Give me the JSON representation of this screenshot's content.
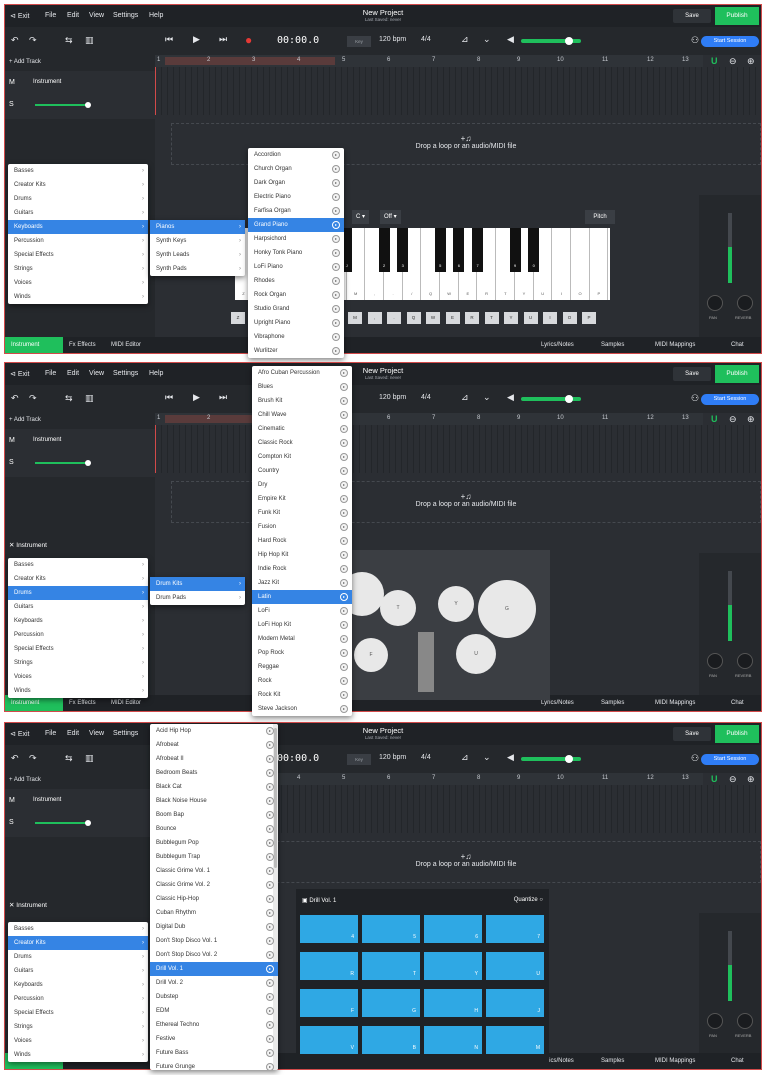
{
  "header": {
    "exit": "Exit",
    "file": "File",
    "edit": "Edit",
    "view": "View",
    "settings": "Settings",
    "help": "Help",
    "title": "New Project",
    "subtitle": "Last Saved: never",
    "save": "Save",
    "publish": "Publish"
  },
  "transport": {
    "time": "00:00.0",
    "key": "Key",
    "tempo": "120 bpm",
    "signature": "4/4",
    "start_session": "Start Session"
  },
  "ruler": [
    "1",
    "2",
    "3",
    "4",
    "5",
    "6",
    "7",
    "8",
    "9",
    "10",
    "11",
    "12",
    "13"
  ],
  "track": {
    "add": "+ Add Track",
    "m": "M",
    "s": "S",
    "name": "Instrument"
  },
  "drop": {
    "icon": "+♫",
    "text": "Drop a loop or an audio/MIDI file"
  },
  "instrument_label": "Instrument",
  "bottom": {
    "instrument": "Instrument",
    "effects": "Fx Effects",
    "midi": "MIDI Editor",
    "lyrics": "Lyrics/Notes",
    "samples": "Samples",
    "mappings": "MIDI Mappings",
    "chat": "Chat"
  },
  "knobs": {
    "pan": "PAN",
    "reverb": "REVERB"
  },
  "categories": [
    "Basses",
    "Creator Kits",
    "Drums",
    "Guitars",
    "Keyboards",
    "Percussion",
    "Special Effects",
    "Strings",
    "Voices",
    "Winds"
  ],
  "piano_ui": {
    "octave": "C",
    "oct_off": "Off",
    "pitch": "Pitch",
    "white_keys": [
      "Z",
      "X",
      "C",
      "V",
      "B",
      "N",
      "M",
      ",",
      ".",
      "/",
      "Q",
      "W",
      "E",
      "R",
      "T",
      "Y",
      "U",
      "I",
      "O",
      "P"
    ],
    "black_keys": [
      "S",
      "D",
      "G",
      "H",
      "J",
      "2",
      "3",
      "5",
      "6",
      "7",
      "9",
      "0"
    ],
    "keyrow": [
      "Z",
      "X",
      "C",
      "V",
      "B",
      "N",
      "M",
      ",",
      ".",
      "Q",
      "W",
      "E",
      "R",
      "T",
      "Y",
      "U",
      "I",
      "O",
      "P"
    ]
  },
  "panel1": {
    "sub": [
      "Pianos",
      "Synth Keys",
      "Synth Leads",
      "Synth Pads"
    ],
    "items": [
      "Accordion",
      "Church Organ",
      "Dark Organ",
      "Electric Piano",
      "Farfisa Organ",
      "Grand Piano",
      "Harpsichord",
      "Honky Tonk Piano",
      "LoFi Piano",
      "Rhodes",
      "Rock Organ",
      "Studio Grand",
      "Upright Piano",
      "Vibraphone",
      "Wurlitzer"
    ]
  },
  "panel2": {
    "sub": [
      "Drum Kits",
      "Drum Pads"
    ],
    "items": [
      "Afro Cuban Percussion",
      "Blues",
      "Brush Kit",
      "Chill Wave",
      "Cinematic",
      "Classic Rock",
      "Compton Kit",
      "Country",
      "Dry",
      "Empire Kit",
      "Funk Kit",
      "Fusion",
      "Hard Rock",
      "Hip Hop Kit",
      "Indie Rock",
      "Jazz Kit",
      "Latin",
      "LoFi",
      "LoFi Hop Kit",
      "Modern Metal",
      "Pop Rock",
      "Reggae",
      "Rock",
      "Rock Kit",
      "Steve Jackson"
    ],
    "drum_letters": [
      "T",
      "Y",
      "G",
      "P",
      "B",
      "F",
      "G",
      "S",
      "U"
    ]
  },
  "panel3": {
    "items": [
      "Acid Hip Hop",
      "Afrobeat",
      "Afrobeat II",
      "Bedroom Beats",
      "Black Cat",
      "Black Noise House",
      "Boom Bap",
      "Bounce",
      "Bubblegum Pop",
      "Bubblegum Trap",
      "Classic Grime Vol. 1",
      "Classic Grime Vol. 2",
      "Classic Hip-Hop",
      "Cuban Rhythm",
      "Digital Dub",
      "Don't Stop Disco Vol. 1",
      "Don't Stop Disco Vol. 2",
      "Drill Vol. 1",
      "Drill Vol. 2",
      "Dubstep",
      "EDM",
      "Ethereal Techno",
      "Festive",
      "Future Bass",
      "Future Grunge"
    ],
    "pad_title": "Drill Vol. 1",
    "quantize": "Quantize",
    "pads": [
      "4",
      "5",
      "6",
      "7",
      "R",
      "T",
      "Y",
      "U",
      "F",
      "G",
      "H",
      "J",
      "V",
      "B",
      "N",
      "M"
    ]
  },
  "colors": {
    "accent": "#1fbf5c",
    "select": "#3584e4",
    "pad": "#2fa8e4",
    "record": "#e53935"
  }
}
